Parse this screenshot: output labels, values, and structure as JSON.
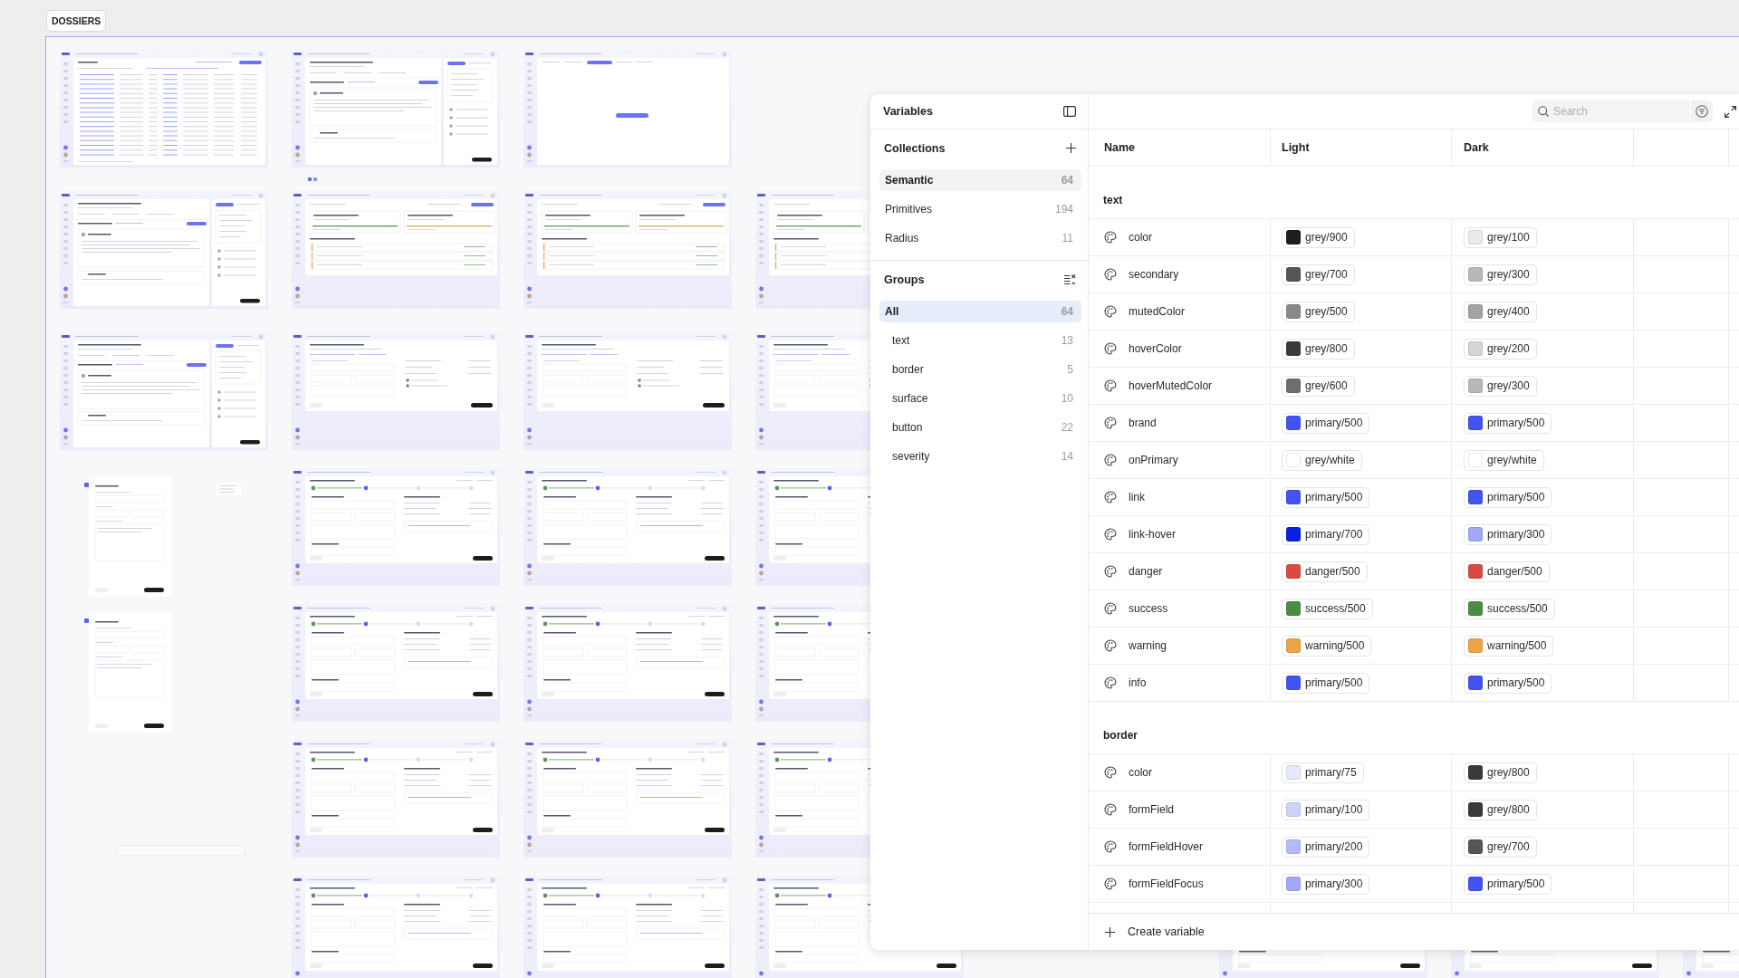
{
  "canvas": {
    "section_label": "DOSSIERS",
    "frame_rows": [
      [
        {
          "kind": "table"
        },
        {
          "kind": "detail",
          "pager": true
        },
        {
          "kind": "blank"
        }
      ],
      [
        {
          "kind": "detail"
        },
        {
          "kind": "cards"
        },
        {
          "kind": "cards"
        },
        {
          "kind": "cards"
        }
      ],
      [
        {
          "kind": "detail"
        },
        {
          "kind": "form"
        },
        {
          "kind": "form"
        },
        {
          "kind": "form"
        }
      ],
      [
        {
          "kind": "sheetmenu"
        },
        {
          "kind": "stepper"
        },
        {
          "kind": "stepper"
        },
        {
          "kind": "stepper"
        }
      ],
      [
        {
          "kind": "sheet"
        },
        {
          "kind": "stepper"
        },
        {
          "kind": "stepper"
        },
        {
          "kind": "stepper"
        }
      ],
      [
        {
          "kind": "rule"
        },
        {
          "kind": "stepper"
        },
        {
          "kind": "stepper"
        },
        {
          "kind": "stepper"
        }
      ],
      [
        null,
        {
          "kind": "stepper"
        },
        {
          "kind": "stepper"
        },
        {
          "kind": "stepper"
        },
        null,
        {
          "kind": "stepper"
        },
        {
          "kind": "stepper"
        },
        {
          "kind": "stepper"
        }
      ]
    ]
  },
  "variables_panel": {
    "title": "Variables",
    "collections": {
      "title": "Collections",
      "items": [
        {
          "name": "Semantic",
          "count": "64",
          "selected": true
        },
        {
          "name": "Primitives",
          "count": "194",
          "selected": false
        },
        {
          "name": "Radius",
          "count": "11",
          "selected": false
        }
      ]
    },
    "groups": {
      "title": "Groups",
      "items": [
        {
          "name": "All",
          "count": "64",
          "selected": true,
          "children": [
            {
              "name": "text",
              "count": "13",
              "selected": false
            },
            {
              "name": "border",
              "count": "5",
              "selected": false
            },
            {
              "name": "surface",
              "count": "10",
              "selected": false
            },
            {
              "name": "button",
              "count": "22",
              "selected": false
            },
            {
              "name": "severity",
              "count": "14",
              "selected": false
            }
          ]
        }
      ]
    },
    "search": {
      "placeholder": "Search"
    },
    "table": {
      "columns": [
        "Name",
        "Light",
        "Dark"
      ],
      "groups": [
        {
          "name": "text",
          "rows": [
            {
              "name": "color",
              "values": [
                {
                  "label": "grey/900",
                  "color": "#1f1f1f"
                },
                {
                  "label": "grey/100",
                  "color": "#ebebeb"
                }
              ]
            },
            {
              "name": "secondary",
              "values": [
                {
                  "label": "grey/700",
                  "color": "#555555"
                },
                {
                  "label": "grey/300",
                  "color": "#b8b8b8"
                }
              ]
            },
            {
              "name": "mutedColor",
              "values": [
                {
                  "label": "grey/500",
                  "color": "#898989"
                },
                {
                  "label": "grey/400",
                  "color": "#a2a2a2"
                }
              ]
            },
            {
              "name": "hoverColor",
              "values": [
                {
                  "label": "grey/800",
                  "color": "#3a3a3a"
                },
                {
                  "label": "grey/200",
                  "color": "#d5d5d5"
                }
              ]
            },
            {
              "name": "hoverMutedColor",
              "values": [
                {
                  "label": "grey/600",
                  "color": "#6e6e6e"
                },
                {
                  "label": "grey/300",
                  "color": "#b8b8b8"
                }
              ]
            },
            {
              "name": "brand",
              "values": [
                {
                  "label": "primary/500",
                  "color": "#4353f2"
                },
                {
                  "label": "primary/500",
                  "color": "#4353f2"
                }
              ]
            },
            {
              "name": "onPrimary",
              "values": [
                {
                  "label": "grey/white",
                  "color": "#ffffff"
                },
                {
                  "label": "grey/white",
                  "color": "#ffffff"
                }
              ]
            },
            {
              "name": "link",
              "values": [
                {
                  "label": "primary/500",
                  "color": "#4353f2"
                },
                {
                  "label": "primary/500",
                  "color": "#4353f2"
                }
              ]
            },
            {
              "name": "link-hover",
              "values": [
                {
                  "label": "primary/700",
                  "color": "#0b20e6"
                },
                {
                  "label": "primary/300",
                  "color": "#a1a8f6"
                }
              ]
            },
            {
              "name": "danger",
              "values": [
                {
                  "label": "danger/500",
                  "color": "#d84a42"
                },
                {
                  "label": "danger/500",
                  "color": "#d84a42"
                }
              ]
            },
            {
              "name": "success",
              "values": [
                {
                  "label": "success/500",
                  "color": "#4b8c44"
                },
                {
                  "label": "success/500",
                  "color": "#4b8c44"
                }
              ]
            },
            {
              "name": "warning",
              "values": [
                {
                  "label": "warning/500",
                  "color": "#eca447"
                },
                {
                  "label": "warning/500",
                  "color": "#eca447"
                }
              ]
            },
            {
              "name": "info",
              "values": [
                {
                  "label": "primary/500",
                  "color": "#4353f2"
                },
                {
                  "label": "primary/500",
                  "color": "#4353f2"
                }
              ]
            }
          ]
        },
        {
          "name": "border",
          "rows": [
            {
              "name": "color",
              "values": [
                {
                  "label": "primary/75",
                  "color": "#e6e8fd"
                },
                {
                  "label": "grey/800",
                  "color": "#3a3a3a"
                }
              ]
            },
            {
              "name": "formField",
              "values": [
                {
                  "label": "primary/100",
                  "color": "#ced2fb"
                },
                {
                  "label": "grey/800",
                  "color": "#3a3a3a"
                }
              ]
            },
            {
              "name": "formFieldHover",
              "values": [
                {
                  "label": "primary/200",
                  "color": "#b5bbf9"
                },
                {
                  "label": "grey/700",
                  "color": "#555555"
                }
              ]
            },
            {
              "name": "formFieldFocus",
              "values": [
                {
                  "label": "primary/300",
                  "color": "#a1a8f6"
                },
                {
                  "label": "primary/500",
                  "color": "#4353f2"
                }
              ]
            }
          ]
        }
      ]
    },
    "footer": {
      "create_label": "Create variable"
    }
  }
}
